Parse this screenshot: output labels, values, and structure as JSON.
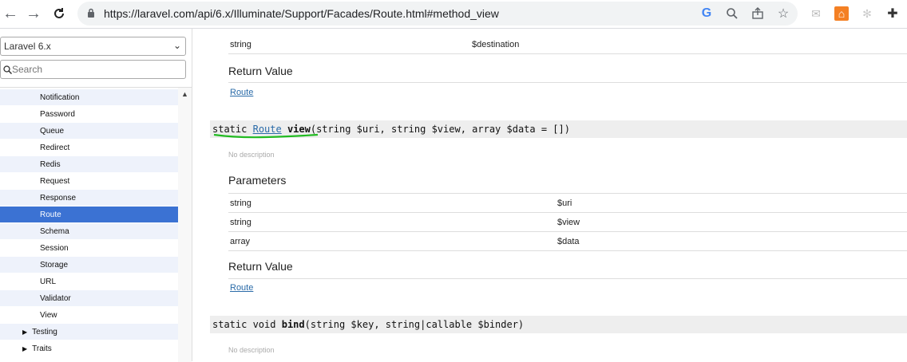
{
  "browser": {
    "url": "https://laravel.com/api/6.x/Illuminate/Support/Facades/Route.html#method_view"
  },
  "sidebar": {
    "version_select": "Laravel 6.x",
    "search_placeholder": "Search",
    "items": [
      {
        "label": "Notification"
      },
      {
        "label": "Password"
      },
      {
        "label": "Queue"
      },
      {
        "label": "Redirect"
      },
      {
        "label": "Redis"
      },
      {
        "label": "Request"
      },
      {
        "label": "Response"
      },
      {
        "label": "Route"
      },
      {
        "label": "Schema"
      },
      {
        "label": "Session"
      },
      {
        "label": "Storage"
      },
      {
        "label": "URL"
      },
      {
        "label": "Validator"
      },
      {
        "label": "View"
      }
    ],
    "folders": [
      {
        "label": "Testing"
      },
      {
        "label": "Traits"
      }
    ]
  },
  "main": {
    "top_param": {
      "type": "string",
      "name": "$destination"
    },
    "return_value_heading": "Return Value",
    "return_link_1": "Route",
    "method_view": {
      "static": "static",
      "return_type": "Route",
      "name": "view",
      "args": "(string $uri, string $view, array $data = [])",
      "description": "No description",
      "parameters_heading": "Parameters",
      "params": [
        {
          "type": "string",
          "name": "$uri"
        },
        {
          "type": "string",
          "name": "$view"
        },
        {
          "type": "array",
          "name": "$data"
        }
      ],
      "return_heading": "Return Value",
      "return_link": "Route"
    },
    "method_bind": {
      "prefix": "static void",
      "name": "bind",
      "args": "(string $key, string|callable $binder)",
      "description": "No description"
    }
  }
}
